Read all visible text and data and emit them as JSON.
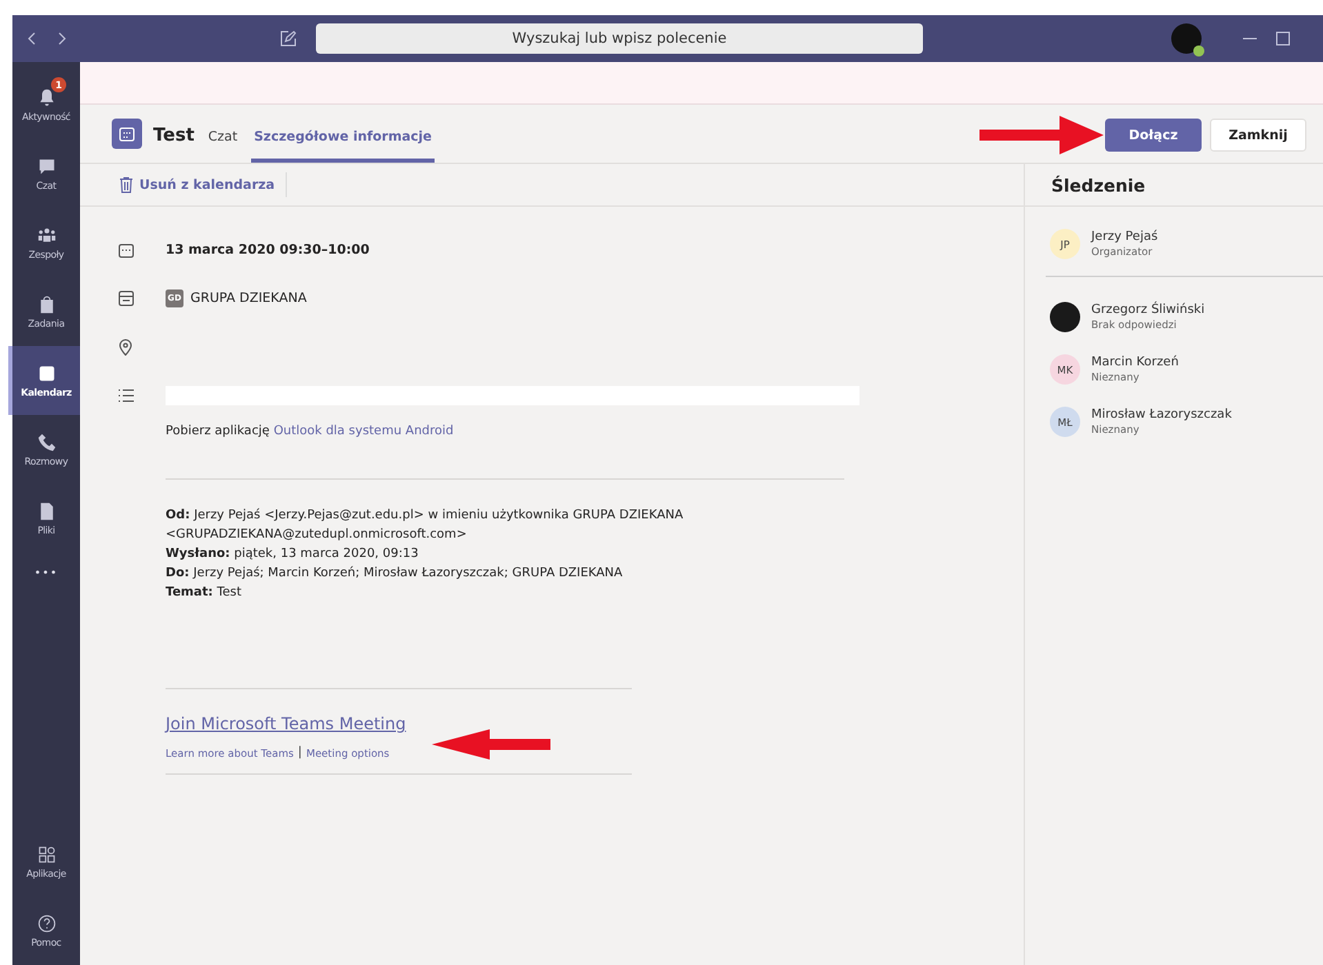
{
  "titlebar": {
    "search_placeholder": "Wyszukaj lub wpisz polecenie"
  },
  "sidebar": {
    "items": [
      {
        "label": "Aktywność",
        "kind": "bell",
        "selected": false,
        "badge": "1"
      },
      {
        "label": "Czat",
        "kind": "chat",
        "selected": false
      },
      {
        "label": "Zespoły",
        "kind": "teams",
        "selected": false
      },
      {
        "label": "Zadania",
        "kind": "bag",
        "selected": false
      },
      {
        "label": "Kalendarz",
        "kind": "calendar",
        "selected": true
      },
      {
        "label": "Rozmowy",
        "kind": "phone",
        "selected": false
      },
      {
        "label": "Pliki",
        "kind": "file",
        "selected": false
      }
    ],
    "more": "•••",
    "bottom": [
      {
        "label": "Aplikacje",
        "kind": "apps"
      },
      {
        "label": "Pomoc",
        "kind": "help"
      }
    ]
  },
  "meeting": {
    "title": "Test",
    "tabs": [
      {
        "label": "Czat",
        "selected": false
      },
      {
        "label": "Szczegółowe informacje",
        "selected": true
      }
    ],
    "buttons": {
      "join": "Dołącz",
      "close": "Zamknij"
    },
    "toolbar": {
      "remove": "Usuń z kalendarza"
    },
    "date": "13 marca 2020 09:30–10:00",
    "channel": {
      "initials": "GD",
      "name": "GRUPA DZIEKANA"
    },
    "download": {
      "text": "Pobierz aplikację",
      "link": "Outlook dla systemu Android"
    },
    "email": [
      "**Od:** Jerzy Pejaś <Jerzy.Pejas@zut.edu.pl> w imieniu użytkownika GRUPA DZIEKANA <GRUPADZIEKANA@zutedupl.onmicrosoft.com>",
      "**Wysłano:** piątek, 13 marca 2020, 09:13",
      "**Do:** Jerzy Pejaś; Marcin Korzeń; Mirosław Łazoryszczak; GRUPA DZIEKANA",
      "**Temat:** Test"
    ],
    "join_link": "Join Microsoft Teams Meeting",
    "links": [
      "Learn more about Teams",
      "Meeting options"
    ],
    "separator": "|"
  },
  "tracking": {
    "title": "Śledzenie",
    "organizer": {
      "kind": "initials",
      "initials": "JP",
      "color": "#fcefc4",
      "name": "Jerzy Pejaś",
      "status": "Organizator"
    },
    "attendees": [
      {
        "kind": "photo",
        "name": "Grzegorz Śliwiński",
        "status": "Brak odpowiedzi"
      },
      {
        "kind": "initials",
        "initials": "MK",
        "color": "#f6d6e0",
        "name": "Marcin Korzeń",
        "status": "Nieznany"
      },
      {
        "kind": "initials",
        "initials": "MŁ",
        "color": "#cfdbee",
        "name": "Mirosław Łazoryszczak",
        "status": "Nieznany"
      }
    ]
  }
}
